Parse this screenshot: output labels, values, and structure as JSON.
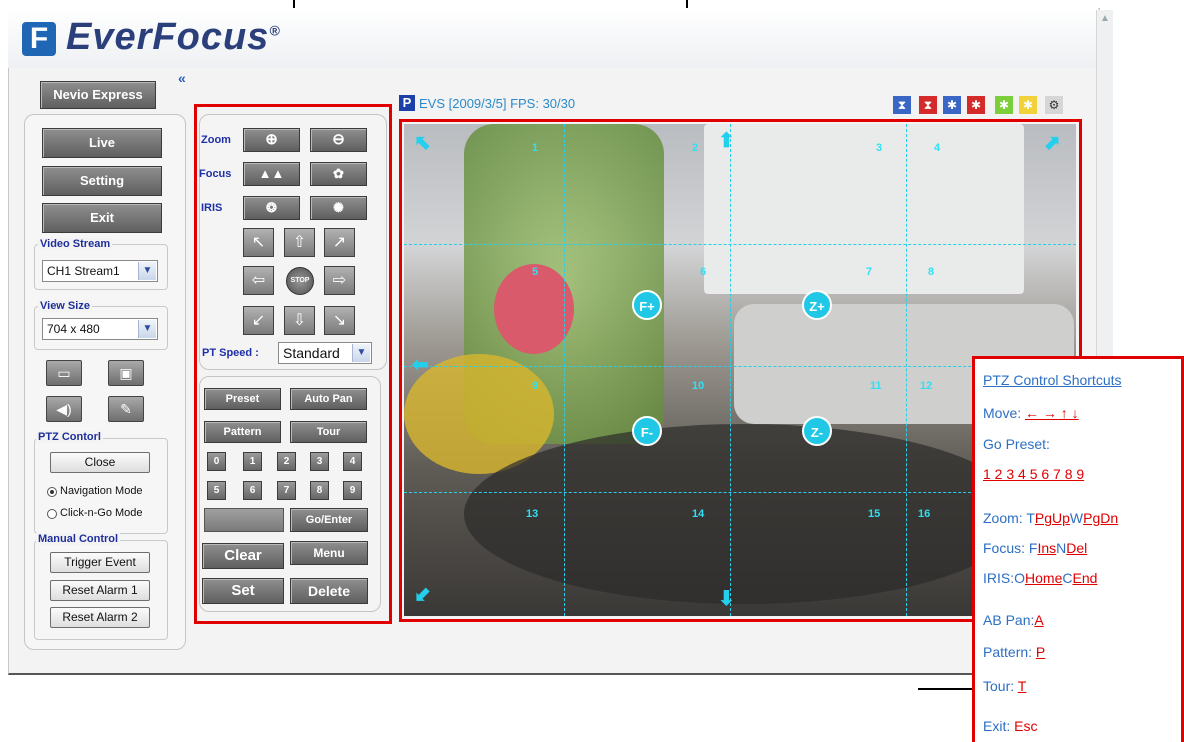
{
  "brand": {
    "logo_mark": "F",
    "name": "EverFocus",
    "reg": "®"
  },
  "sidebar": {
    "product_button": "Nevio Express",
    "collapse": "«",
    "nav": {
      "live": "Live",
      "setting": "Setting",
      "exit": "Exit"
    },
    "video_stream": {
      "label": "Video Stream",
      "value": "CH1 Stream1"
    },
    "view_size": {
      "label": "View Size",
      "value": "704 x 480"
    },
    "ptz_control": {
      "label": "PTZ Contorl",
      "close": "Close",
      "navigation_mode": "Navigation Mode",
      "click_n_go_mode": "Click-n-Go Mode",
      "selected": "navigation"
    },
    "manual_control": {
      "label": "Manual Control",
      "trigger": "Trigger Event",
      "reset1": "Reset Alarm 1",
      "reset2": "Reset Alarm 2"
    }
  },
  "ptz": {
    "zoom": "Zoom",
    "focus": "Focus",
    "iris": "IRIS",
    "stop": "STOP",
    "pt_speed_label": "PT Speed :",
    "pt_speed_value": "Standard",
    "preset": "Preset",
    "auto_pan": "Auto Pan",
    "pattern": "Pattern",
    "tour": "Tour",
    "numbers": [
      "0",
      "1",
      "2",
      "3",
      "4",
      "5",
      "6",
      "7",
      "8",
      "9"
    ],
    "go_enter": "Go/Enter",
    "clear": "Clear",
    "menu": "Menu",
    "set": "Set",
    "delete": "Delete"
  },
  "video": {
    "badge": "P",
    "info": "EVS [2009/3/5] FPS: 30/30",
    "zones": [
      "1",
      "2",
      "3",
      "4",
      "5",
      "6",
      "7",
      "8",
      "9",
      "10",
      "11",
      "12",
      "13",
      "14",
      "15",
      "16"
    ],
    "controls": {
      "focus_near": "F+",
      "focus_far": "F-",
      "zoom_in": "Z+",
      "zoom_out": "Z-"
    }
  },
  "shortcuts": {
    "title": "PTZ Control Shortcuts",
    "move_label": "Move:",
    "move_keys": "← → ↑ ↓",
    "go_preset_label": "Go Preset:",
    "preset_keys": "1 2 3 4 5 6 7 8 9",
    "zoom_label": "Zoom: T",
    "zoom_t_key": "PgUp",
    "zoom_w": "W",
    "zoom_w_key": "PgDn",
    "focus_label": "Focus: F",
    "focus_f_key": "Ins",
    "focus_n": "N",
    "focus_n_key": "Del",
    "iris_label": "IRIS:O",
    "iris_o_key": "Home",
    "iris_c": "C",
    "iris_c_key": "End",
    "ab_pan_label": "AB Pan:",
    "ab_pan_key": "A",
    "pattern_label": "Pattern:",
    "pattern_key": "P",
    "tour_label": "Tour:",
    "tour_key": "T",
    "exit_label": "Exit:",
    "exit_key": "Esc"
  },
  "colors": {
    "accent_red": "#e00000",
    "link_blue": "#2c6fc4",
    "label_blue": "#1f2f9a",
    "overlay_cyan": "#27d0e8"
  }
}
